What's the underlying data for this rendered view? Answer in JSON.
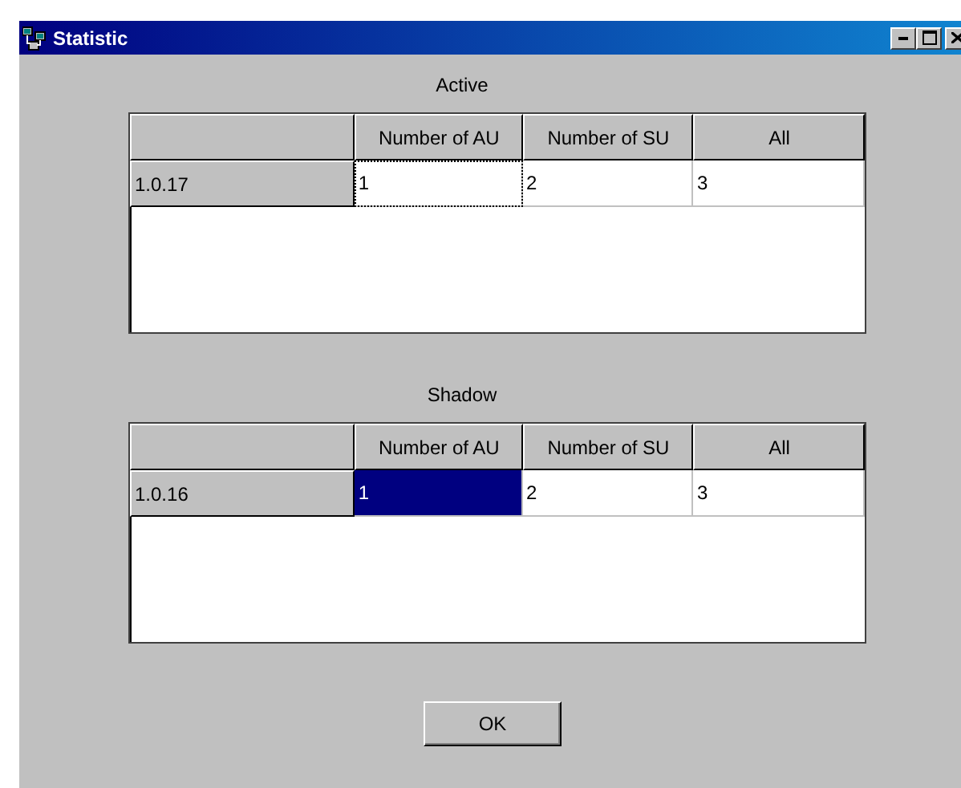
{
  "window": {
    "title": "Statistic"
  },
  "grids": [
    {
      "label": "Active",
      "columns": [
        "Number of AU",
        "Number of SU",
        "All"
      ],
      "rows": [
        {
          "header": "1.0.17",
          "cells": [
            {
              "text": "1",
              "selected": false,
              "focused": true
            },
            {
              "text": "2",
              "selected": false,
              "focused": false
            },
            {
              "text": "3",
              "selected": false,
              "focused": false
            }
          ]
        }
      ]
    },
    {
      "label": "Shadow",
      "columns": [
        "Number of AU",
        "Number of SU",
        "All"
      ],
      "rows": [
        {
          "header": "1.0.16",
          "cells": [
            {
              "text": "1",
              "selected": true,
              "focused": false
            },
            {
              "text": "2",
              "selected": false,
              "focused": false
            },
            {
              "text": "3",
              "selected": false,
              "focused": false
            }
          ]
        }
      ]
    }
  ],
  "buttons": [
    "OK"
  ]
}
